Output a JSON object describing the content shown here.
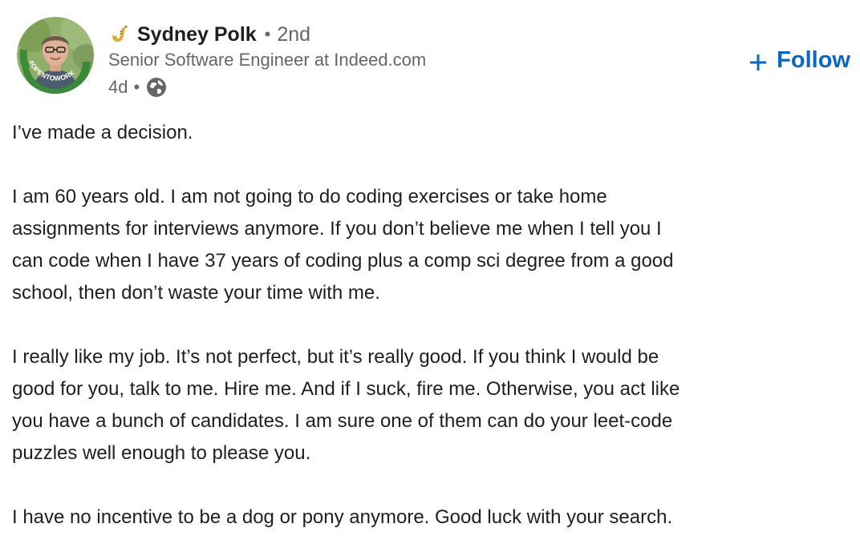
{
  "author": {
    "name": "Sydney Polk",
    "connection": "2nd",
    "headline": "Senior Software Engineer at Indeed.com",
    "avatar_badge": "#OPENTOWORK",
    "name_icon": "saxophone-icon"
  },
  "meta": {
    "time_ago": "4d",
    "visibility_icon": "globe-icon"
  },
  "follow": {
    "label": "Follow",
    "icon": "plus-icon",
    "color": "#0a66c2"
  },
  "post": {
    "paragraphs": [
      {
        "lines": [
          "I’ve made a decision."
        ]
      },
      {
        "lines": [
          "I am 60 years old. I am not going to do coding exercises or take home",
          "assignments for interviews anymore. If you don’t believe me when I tell you I",
          "can code when I have 37 years of coding plus a comp sci degree from a good",
          "school, then don’t waste your time with me."
        ]
      },
      {
        "lines": [
          "I really like my job. It’s not perfect, but it’s really good. If you think I would be",
          "good for you, talk to me. Hire me. And if I suck, fire me. Otherwise, you act like",
          "you have a bunch of candidates. I am sure one of them can do your leet-code",
          "puzzles well enough to please you."
        ]
      },
      {
        "lines": [
          "I have no incentive to be a dog or pony anymore. Good luck with your search."
        ]
      }
    ]
  },
  "colors": {
    "text_primary": "#1f1f1f",
    "text_secondary": "#666666",
    "open_to_work_green": "#3b8a3a"
  }
}
